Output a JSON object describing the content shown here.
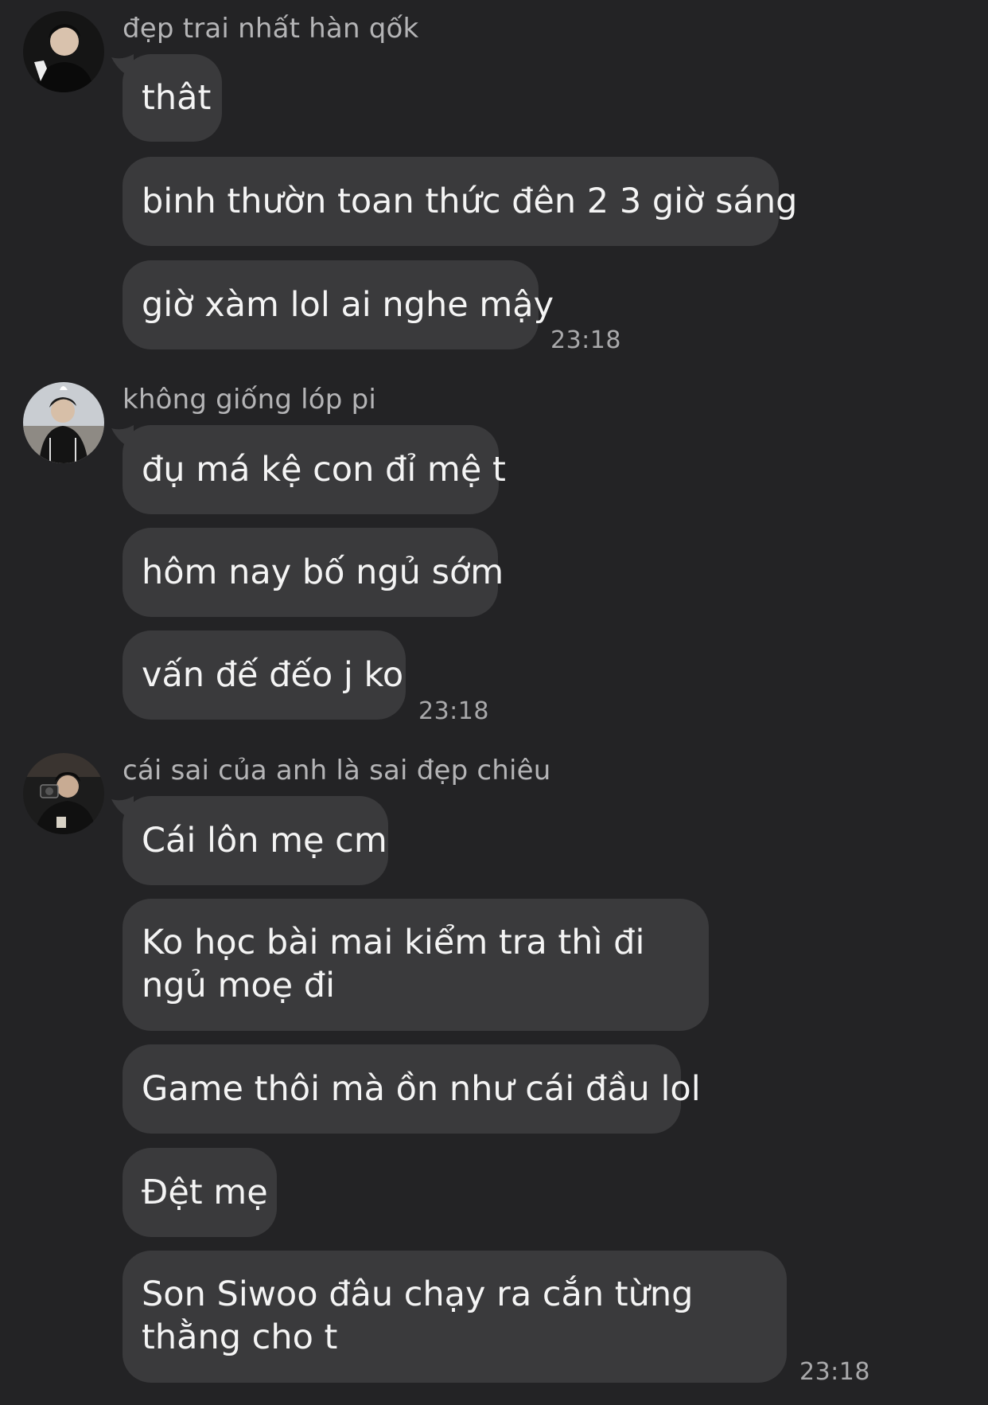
{
  "groups": [
    {
      "sender": "đẹp trai nhất hàn qốk",
      "avatar_icon": "person-avatar-icon",
      "messages": [
        "thât",
        "binh thườn toan thức đên 2 3 giờ sáng",
        "giờ xàm lol ai nghe mậy"
      ],
      "time": "23:18"
    },
    {
      "sender": "không giống lóp pi",
      "avatar_icon": "person-avatar-icon",
      "messages": [
        "đụ má kệ con đỉ mệ t",
        "hôm nay bố ngủ sớm",
        "vấn đế đếo j ko"
      ],
      "time": "23:18"
    },
    {
      "sender": "cái sai của anh là sai đẹp chiêu",
      "avatar_icon": "person-avatar-icon",
      "messages": [
        "Cái lôn mẹ cm",
        "Ko học bài mai kiểm tra thì đi ngủ moẹ đi",
        "Game thôi mà ồn như cái đầu lol",
        "Đệt mẹ",
        "Son Siwoo đâu chạy ra cắn từng thằng cho t"
      ],
      "time": "23:18"
    }
  ],
  "colors": {
    "background": "#232325",
    "bubble": "#3a3a3c",
    "text": "#f4f4f4",
    "muted": "#a9a9ab"
  }
}
